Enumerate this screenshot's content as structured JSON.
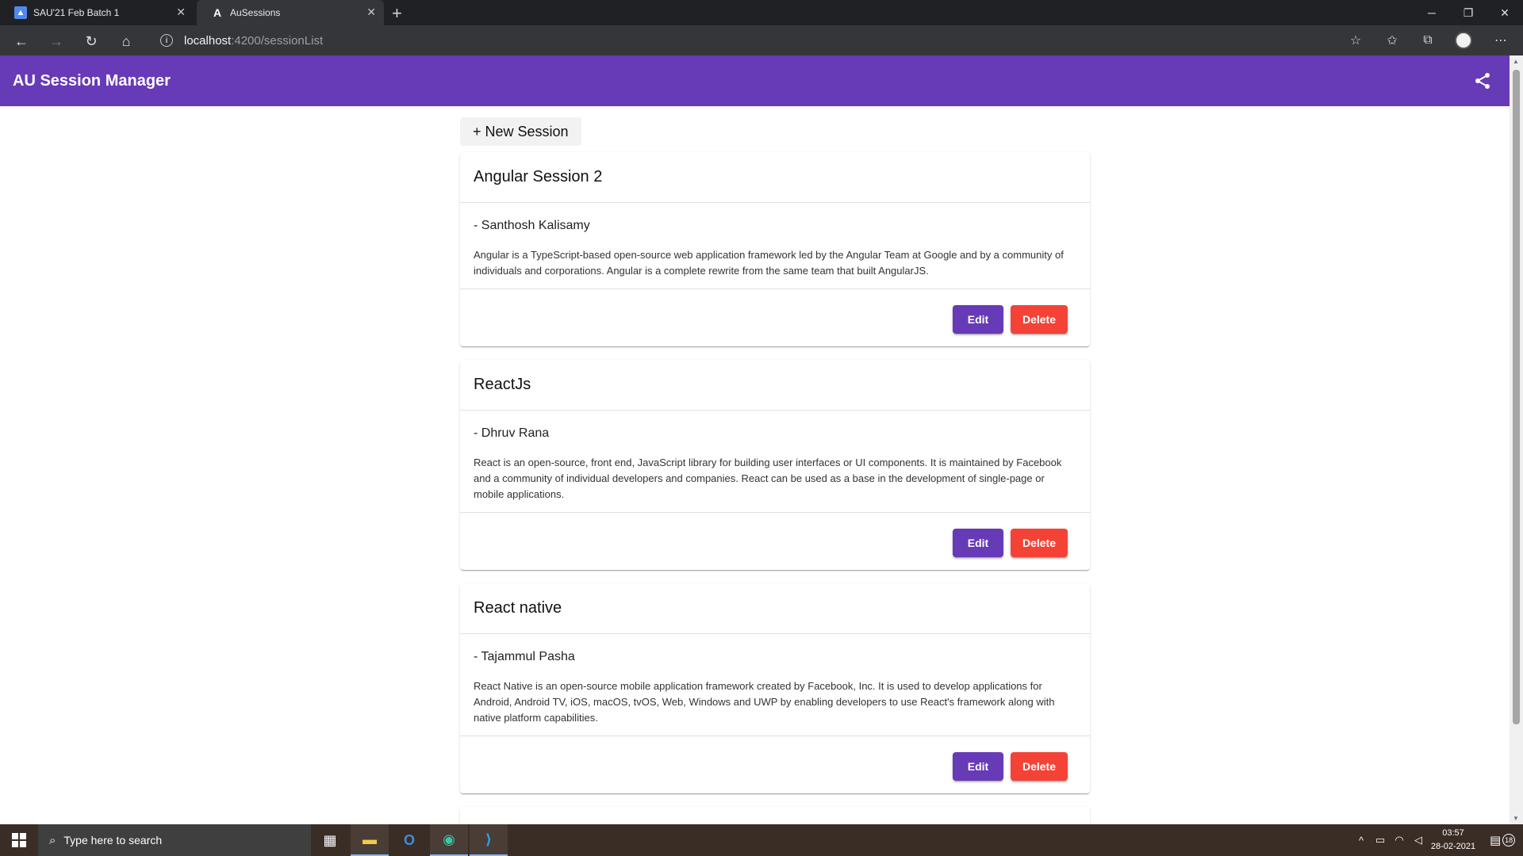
{
  "browser": {
    "tabs": [
      {
        "title": "SAU'21 Feb Batch 1"
      },
      {
        "title": "AuSessions",
        "favicon": "A"
      }
    ],
    "address": {
      "host": "localhost",
      "path": ":4200/sessionList"
    }
  },
  "app": {
    "title": "AU Session Manager",
    "new_session_label": "+ New Session",
    "accent": "#673ab7",
    "danger": "#f44336"
  },
  "sessions": [
    {
      "title": "Angular Session 2",
      "speaker": "- Santhosh Kalisamy",
      "description": "Angular is a TypeScript-based open-source web application framework led by the Angular Team at Google and by a community of individuals and corporations. Angular is a complete rewrite from the same team that built AngularJS.",
      "edit_label": "Edit",
      "delete_label": "Delete"
    },
    {
      "title": "ReactJs",
      "speaker": "- Dhruv Rana",
      "description": "React is an open-source, front end, JavaScript library for building user interfaces or UI components. It is maintained by Facebook and a community of individual developers and companies. React can be used as a base in the development of single-page or mobile applications.",
      "edit_label": "Edit",
      "delete_label": "Delete"
    },
    {
      "title": "React native",
      "speaker": "- Tajammul Pasha",
      "description": "React Native is an open-source mobile application framework created by Facebook, Inc. It is used to develop applications for Android, Android TV, iOS, macOS, tvOS, Web, Windows and UWP by enabling developers to use React's framework along with native platform capabilities.",
      "edit_label": "Edit",
      "delete_label": "Delete"
    }
  ],
  "taskbar": {
    "search_placeholder": "Type here to search",
    "time": "03:57",
    "date": "28-02-2021",
    "notification_count": "18"
  }
}
